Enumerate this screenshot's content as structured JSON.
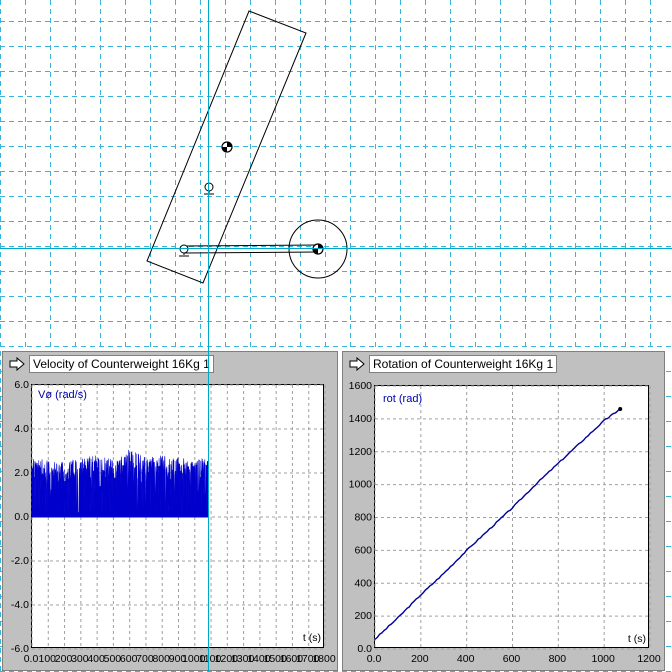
{
  "panels": [
    {
      "title": "Velocity of Counterweight 16Kg 1",
      "series_label": "Vø (rad/s)",
      "x_unit": "t (s)"
    },
    {
      "title": "Rotation of Counterweight 16Kg 1",
      "series_label": "rot (rad)",
      "x_unit": "t (s)"
    }
  ],
  "chart_data": [
    {
      "type": "area",
      "title": "Velocity of Counterweight 16Kg 1",
      "xlabel": "t (s)",
      "ylabel": "Vø (rad/s)",
      "xlim": [
        0,
        1800
      ],
      "ylim": [
        -6,
        6
      ],
      "x_ticks": [
        0,
        100,
        200,
        300,
        400,
        500,
        600,
        700,
        800,
        900,
        1000,
        1100,
        1200,
        1300,
        1400,
        1500,
        1600,
        1700,
        1800
      ],
      "y_ticks": [
        -6,
        -4,
        -2,
        0,
        2,
        4,
        6
      ],
      "x_tick_labels": [
        "0.0",
        "100",
        "200",
        "300",
        "400",
        "500",
        "600",
        "700",
        "800",
        "900",
        "1000",
        "1100",
        "1200",
        "1300",
        "1400",
        "1500",
        "1600",
        "1700",
        "1800"
      ],
      "y_tick_labels": [
        "-6.0",
        "-4.0",
        "-2.0",
        "0.0",
        "2.0",
        "4.0",
        "6.0"
      ],
      "grid": true,
      "series": [
        {
          "color": "#0000cc",
          "x": [
            0,
            1080
          ],
          "y_min": 0,
          "y_max_typical": 2.6,
          "y_max_peak": 3.1,
          "envelope": [
            [
              0,
              2.7
            ],
            [
              100,
              2.6
            ],
            [
              200,
              2.5
            ],
            [
              300,
              2.7
            ],
            [
              400,
              2.8
            ],
            [
              500,
              2.6
            ],
            [
              560,
              2.8
            ],
            [
              600,
              3.1
            ],
            [
              700,
              2.7
            ],
            [
              800,
              2.8
            ],
            [
              900,
              2.7
            ],
            [
              1000,
              2.6
            ],
            [
              1080,
              2.7
            ]
          ]
        }
      ]
    },
    {
      "type": "line",
      "title": "Rotation of Counterweight 16Kg 1",
      "xlabel": "t (s)",
      "ylabel": "rot (rad)",
      "xlim": [
        0,
        1200
      ],
      "ylim": [
        0,
        1600
      ],
      "x_ticks": [
        0,
        200,
        400,
        600,
        800,
        1000,
        1200
      ],
      "y_ticks": [
        0,
        200,
        400,
        600,
        800,
        1000,
        1200,
        1400,
        1600
      ],
      "x_tick_labels": [
        "0.0",
        "200",
        "400",
        "600",
        "800",
        "1000",
        "1200"
      ],
      "y_tick_labels": [
        "0.0",
        "200",
        "400",
        "600",
        "800",
        "1000",
        "1200",
        "1400",
        "1600"
      ],
      "grid": true,
      "series": [
        {
          "color": "#000099",
          "x": [
            0,
            100,
            200,
            300,
            400,
            500,
            600,
            700,
            800,
            900,
            1000,
            1070
          ],
          "y": [
            60,
            190,
            330,
            460,
            600,
            730,
            860,
            1000,
            1130,
            1260,
            1390,
            1460
          ]
        }
      ]
    }
  ]
}
